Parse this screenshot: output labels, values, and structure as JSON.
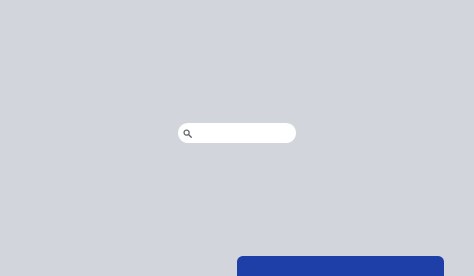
{
  "search": {
    "value": "",
    "placeholder": "",
    "icon": "search-icon"
  },
  "colors": {
    "background": "#d2d5dc",
    "search_background": "#ffffff",
    "icon": "#5f6368",
    "panel_accent": "#1e3fa8"
  }
}
